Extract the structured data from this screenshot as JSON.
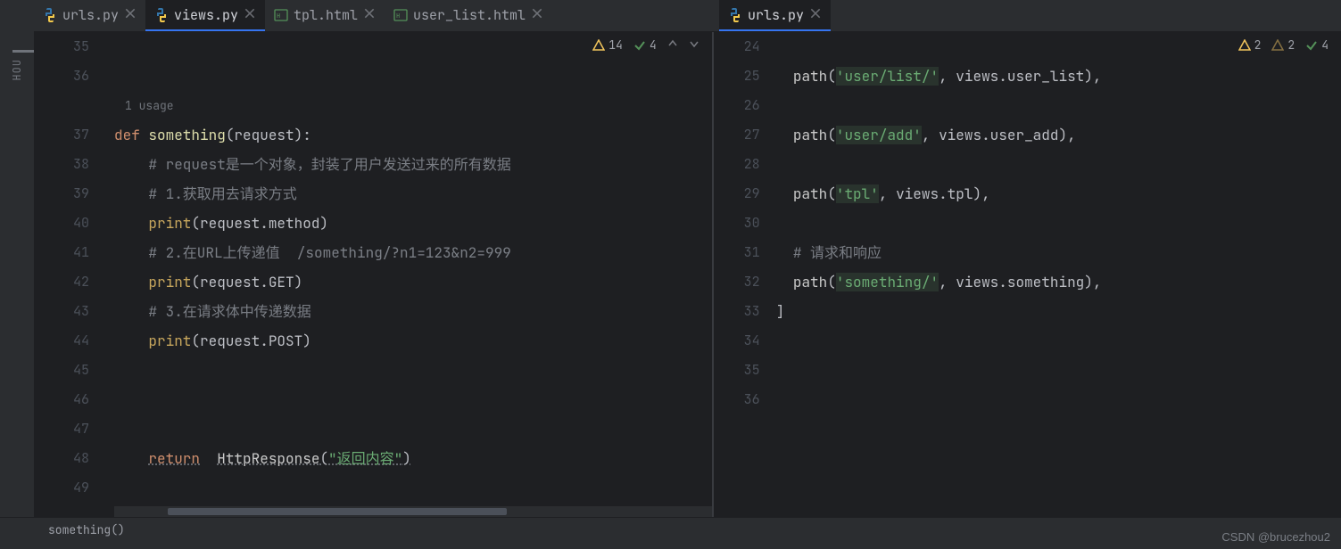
{
  "tabs_left": [
    {
      "label": "urls.py",
      "active": false,
      "type": "py"
    },
    {
      "label": "views.py",
      "active": true,
      "type": "py"
    },
    {
      "label": "tpl.html",
      "active": false,
      "type": "html"
    },
    {
      "label": "user_list.html",
      "active": false,
      "type": "html"
    }
  ],
  "tab_right": {
    "label": "urls.py",
    "type": "py"
  },
  "sidebar_label": "HOU",
  "inspections_left": {
    "warn": "14",
    "ok": "4"
  },
  "inspections_right": {
    "warn1": "2",
    "warn2": "2",
    "ok": "4"
  },
  "usage_hint": "1 usage",
  "left_code": {
    "start": 35,
    "lines": [
      {
        "n": 35,
        "html": ""
      },
      {
        "n": 36,
        "html": ""
      },
      {
        "usage": true
      },
      {
        "n": 37,
        "html": "<span class='kw'>def </span><span class='fn-yellow'>something</span><span class='punct'>(request):</span>"
      },
      {
        "n": 38,
        "html": "    <span class='cm'># request是一个对象，封装了用户发送过来的所有数据</span>"
      },
      {
        "n": 39,
        "html": "    <span class='cm'># 1.获取用去请求方式</span>"
      },
      {
        "n": 40,
        "html": "    <span class='fn-call'>print</span><span class='punct'>(request.method)</span>"
      },
      {
        "n": 41,
        "html": "    <span class='cm'># 2.在URL上传递值  /something/?n1=123&amp;n2=999</span>"
      },
      {
        "n": 42,
        "html": "    <span class='fn-call'>print</span><span class='punct'>(request.GET)</span>"
      },
      {
        "n": 43,
        "html": "    <span class='cm'># 3.在请求体中传递数据</span>"
      },
      {
        "n": 44,
        "html": "    <span class='fn-call'>print</span><span class='punct'>(request.POST)</span>"
      },
      {
        "n": 45,
        "html": ""
      },
      {
        "n": 46,
        "html": ""
      },
      {
        "n": 47,
        "html": ""
      },
      {
        "n": 48,
        "html": "    <span class='kw dotted'>return</span>  <span class='fn dotted'>HttpResponse</span><span class='punct dotted'>(</span><span class='str dotted'>\"返回内容\"</span><span class='punct dotted'>)</span>"
      },
      {
        "n": 49,
        "html": ""
      }
    ]
  },
  "right_code": {
    "lines": [
      {
        "n": 24,
        "html": "  <span class='fn'>path</span><span class='punct'>(</span><span class='str hl-str'>'user/list/'</span><span class='punct'>, views.user_list),</span>"
      },
      {
        "n": 25,
        "skip": true
      },
      {
        "n": 26,
        "html": ""
      },
      {
        "n": 27,
        "html": "  <span class='fn'>path</span><span class='punct'>(</span><span class='str hl-str'>'user/add'</span><span class='punct'>, views.user_add),</span>"
      },
      {
        "n": 28,
        "html": ""
      },
      {
        "n": 29,
        "html": "  <span class='fn'>path</span><span class='punct'>(</span><span class='str hl-str'>'tpl'</span><span class='punct'>, views.tpl),</span>"
      },
      {
        "n": 30,
        "html": ""
      },
      {
        "n": 31,
        "html": "  <span class='cm'># 请求和响应</span>"
      },
      {
        "n": 32,
        "html": "  <span class='fn'>path</span><span class='punct'>(</span><span class='str hl-str'>'something/'</span><span class='punct'>, views.something),</span>"
      },
      {
        "n": 33,
        "html": "<span class='punct'>]</span>"
      },
      {
        "n": 34,
        "html": ""
      },
      {
        "n": 35,
        "html": ""
      },
      {
        "n": 36,
        "html": ""
      }
    ]
  },
  "breadcrumb": "something()",
  "csdn": "CSDN @brucezhou2"
}
